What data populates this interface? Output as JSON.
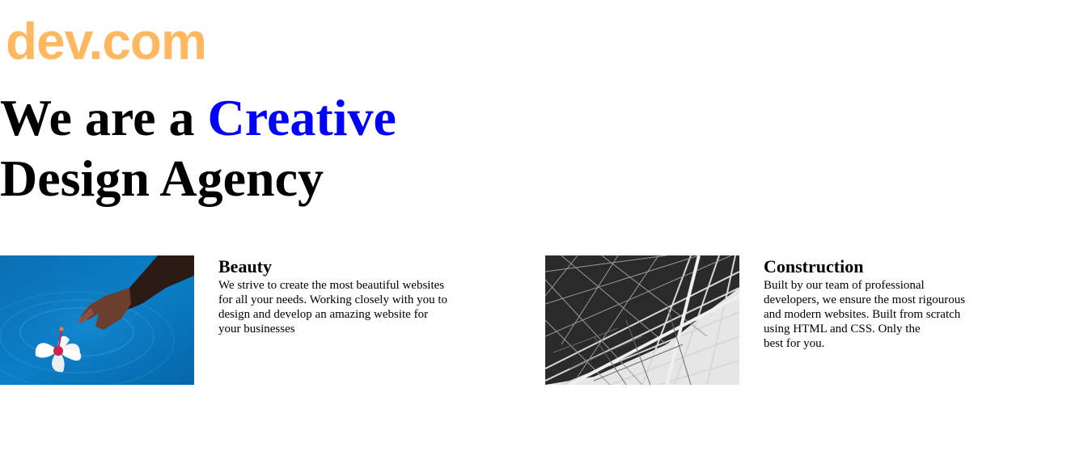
{
  "logo": {
    "text": "dev.com",
    "color": "#ffb85f"
  },
  "hero": {
    "prefix": "We are a ",
    "accent": "Creative",
    "suffix": "Design Agency",
    "accent_color": "#0000ff"
  },
  "cards": [
    {
      "title": "Beauty",
      "body": "We strive to create the most beautiful websites\nfor all your needs. Working closely with you to\ndesign and develop an amazing website for\nyour businesses",
      "image": "flower-in-water-photo"
    },
    {
      "title": "Construction",
      "body": "Built by our team of professional\ndevelopers, we ensure the most rigourous\nand modern websites. Built from scratch\nusing HTML and CSS. Only the\nbest for you.",
      "image": "steel-structure-photo"
    }
  ]
}
